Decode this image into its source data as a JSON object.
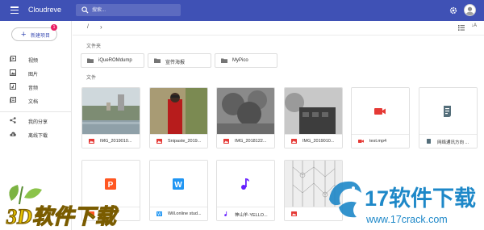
{
  "header": {
    "title": "Cloudreve",
    "search_placeholder": "搜索...",
    "icons": [
      "menu-icon",
      "search-icon",
      "gear-icon"
    ],
    "brand_color": "#3f51b5"
  },
  "sidebar": {
    "new_button": "新建项目",
    "new_badge": "1",
    "items": [
      {
        "label": "视频",
        "icon": "video-library-icon"
      },
      {
        "label": "图片",
        "icon": "image-icon"
      },
      {
        "label": "音频",
        "icon": "music-icon"
      },
      {
        "label": "文档",
        "icon": "document-icon"
      },
      {
        "label": "我的分享",
        "icon": "share-icon"
      },
      {
        "label": "离线下载",
        "icon": "download-icon"
      }
    ]
  },
  "toolbar": {
    "breadcrumb_root": "/",
    "chevron": "›",
    "sort_label": "↓A"
  },
  "sections": {
    "folders": "文件夹",
    "files": "文件"
  },
  "folders": [
    {
      "name": "iQueROMdump"
    },
    {
      "name": "宣传海报"
    },
    {
      "name": "MyPico"
    }
  ],
  "files": [
    {
      "name": "IMG_2019010...",
      "type": "image"
    },
    {
      "name": "Snipaste_2019...",
      "type": "image"
    },
    {
      "name": "IMG_2018122...",
      "type": "image"
    },
    {
      "name": "IMG_2019010...",
      "type": "image"
    },
    {
      "name": "test.mp4",
      "type": "video"
    },
    {
      "name": "网络通讯方向 ...",
      "type": "document"
    },
    {
      "name": "",
      "type": "powerpoint"
    },
    {
      "name": "Will.online stud...",
      "type": "word"
    },
    {
      "name": "神山羊-YELLO...",
      "type": "audio"
    },
    {
      "name": "",
      "type": "image"
    }
  ],
  "watermarks": {
    "left": "3D软件下载",
    "right_title": "17软件下载",
    "right_url": "www.17crack.com"
  },
  "colors": {
    "image_icon": "#e53935",
    "video_icon": "#e53935",
    "word_icon": "#2196f3",
    "audio_icon": "#651fff",
    "ppt_icon": "#ff5722",
    "doc_icon": "#546e7a",
    "badge": "#e91e63"
  }
}
